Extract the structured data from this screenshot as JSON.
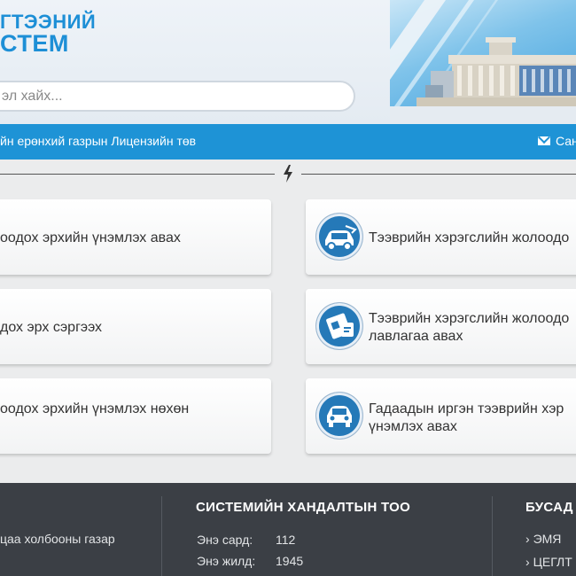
{
  "header": {
    "logo_line1": "ГТЭЭНИЙ",
    "logo_line2": "СТЕМ",
    "search_placeholder": "эл хайх..."
  },
  "bar": {
    "title": "йн ерөнхий газрын Лицензийн төв",
    "contact_label": "Сан"
  },
  "services": [
    {
      "label": "оодох эрхийн үнэмлэх авах"
    },
    {
      "label": "Тээврийн хэрэгслийн жолоодо"
    },
    {
      "label": "дох эрх сэргээх"
    },
    {
      "label_line1": "Тээврийн хэрэгслийн жолоодо",
      "label_line2": "лавлагаа авах"
    },
    {
      "label": "оодох эрхийн үнэмлэх нөхөн"
    },
    {
      "label_line1": "Гадаадын иргэн тээврийн хэр",
      "label_line2": "үнэмлэх авах"
    }
  ],
  "footer": {
    "left_text": "цаа холбооны газар",
    "stats": {
      "heading": "СИСТЕМИЙН ХАНДАЛТЫН ТОО",
      "month_label": "Энэ сард:",
      "month_value": "112",
      "year_label": "Энэ жилд:",
      "year_value": "1945"
    },
    "other": {
      "heading": "БУСАД",
      "link1": "ЭМЯ",
      "link2": "ЦЕГЛТ"
    }
  },
  "colors": {
    "brand_blue": "#1e93d6",
    "icon_blue": "#2579b8",
    "footer_bg": "#3b3f45"
  }
}
